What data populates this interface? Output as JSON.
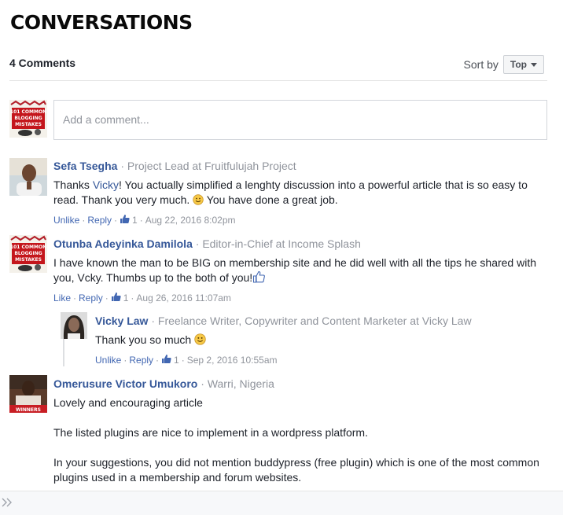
{
  "page": {
    "heading": "CONVERSATIONS"
  },
  "toolbar": {
    "count_label": "4 Comments",
    "sort_label": "Sort by",
    "sort_value": "Top"
  },
  "composer": {
    "placeholder": "Add a comment..."
  },
  "comments": [
    {
      "name": "Sefa Tsegha",
      "subtitle": "Project Lead at Fruitfulujah Project",
      "body_prefix": "Thanks ",
      "body_link": "Vicky",
      "body_mid": "! You actually simplified a lenghty discussion into a powerful article that is so easy to read. Thank you very much. ",
      "body_suffix": " You have done a great job.",
      "action1": "Unlike",
      "action2": "Reply",
      "likes": "1",
      "time": "Aug 22, 2016 8:02pm"
    },
    {
      "name": "Otunba Adeyinka Damilola",
      "subtitle": "Editor-in-Chief at Income Splash",
      "body": "I have known the man to be BIG on membership site and he did well with all the tips he shared with you, Vcky. Thumbs up to the both of you!",
      "action1": "Like",
      "action2": "Reply",
      "likes": "1",
      "time": "Aug 26, 2016 11:07am"
    },
    {
      "name": "Vicky Law",
      "subtitle": "Freelance Writer, Copywriter and Content Marketer at Vicky Law",
      "body": "Thank you so much ",
      "action1": "Unlike",
      "action2": "Reply",
      "likes": "1",
      "time": "Sep 2, 2016 10:55am"
    },
    {
      "name": "Omerusure Victor Umukoro",
      "subtitle": "Warri, Nigeria",
      "para1": "Lovely and encouraging article",
      "para2": "The listed plugins are nice to implement in a wordpress platform.",
      "para3": "In your suggestions, you did not mention buddypress (free plugin) which is one of the most common plugins used in a membership and forum websites."
    }
  ],
  "avatar_texts": {
    "logo_line1": "101 COMMON",
    "logo_line2": "BLOGGING",
    "logo_line3": "MISTAKES",
    "winners_banner": "WINNERS"
  },
  "colors": {
    "name_blue": "#365899",
    "action_blue": "#4267b2",
    "meta_gray": "#90949c",
    "text_dark": "#1d2129"
  },
  "icons": {
    "like": "thumbs-up-icon",
    "emoji": "smile-emoji-icon",
    "expand": "double-chevron-right-icon"
  }
}
